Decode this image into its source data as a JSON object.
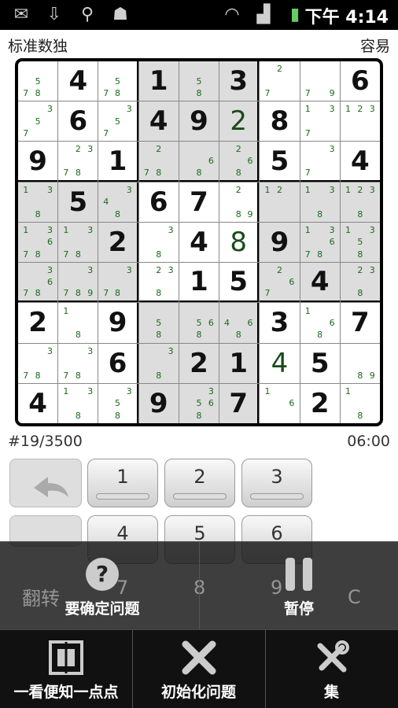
{
  "status_bar": {
    "time": "下午 4:14",
    "icons": [
      "mail-icon",
      "download-icon",
      "usb-icon",
      "android-debug-icon",
      "wifi-icon",
      "signal-icon",
      "battery-icon"
    ]
  },
  "header": {
    "title": "标准数独",
    "difficulty": "容易"
  },
  "puzzle": {
    "cells": [
      [
        "n:57 8",
        "4",
        "n:5 78",
        "1",
        "n:5 8",
        "3",
        "n:2 7",
        "n:7 9",
        "6"
      ],
      [
        "n:35 7",
        "6",
        "n:35 7",
        "4",
        "9",
        "u:2",
        "8",
        "n:13 7",
        "n:123"
      ],
      [
        "9",
        "n:23 78",
        "1",
        "n:2 78",
        "n:6 8",
        "n:26 8",
        "5",
        "n:3 7",
        "4"
      ],
      [
        "n:13 8",
        "5",
        "n:43 8",
        "6",
        "7",
        "n:2 89",
        "n:12",
        "n:13 8",
        "n:123 8"
      ],
      [
        "n:13 6 78",
        "n:13 78",
        "2",
        "n:3 8",
        "4",
        "u:8",
        "9",
        "n:13 6 78",
        "n:13 5 8"
      ],
      [
        "n:3 6 78",
        "n:3 789",
        "n:3 78",
        "n:23 8",
        "1",
        "5",
        "n:2 6 7",
        "4",
        "n:23 8"
      ],
      [
        "2",
        "n:1 8",
        "9",
        "n:5 8",
        "n:56 8",
        "n:46 8",
        "3",
        "n:1 6 8",
        "7"
      ],
      [
        "n:3 78",
        "n:3 78",
        "6",
        "n:3 8",
        "2",
        "1",
        "u:4",
        "5",
        "n:89"
      ],
      [
        "4",
        "n:13 8",
        "n:3 58",
        "9",
        "n:3 56 8",
        "7",
        "n:1 6",
        "2",
        "n:1 8"
      ]
    ]
  },
  "info": {
    "puzzle_number": "#19/3500",
    "timer": "06:00"
  },
  "keypad": {
    "keys": [
      "1",
      "2",
      "3",
      "4",
      "5",
      "6",
      "7",
      "8",
      "9"
    ],
    "clear_label": "C",
    "flip_label": "翻转"
  },
  "menu": {
    "top_items": [
      {
        "label": "要确定问题",
        "icon": "help-icon"
      },
      {
        "label": "暂停",
        "icon": "pause-icon"
      }
    ],
    "bottom_items": [
      {
        "label": "一看便知一点点",
        "icon": "hint-icon"
      },
      {
        "label": "初始化问题",
        "icon": "reset-icon"
      },
      {
        "label": "集",
        "icon": "settings-icon"
      }
    ]
  }
}
